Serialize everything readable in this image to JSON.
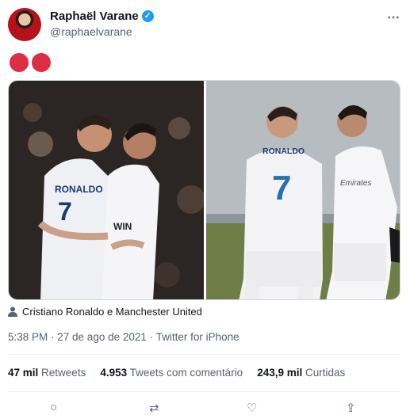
{
  "author": {
    "name": "Raphaël Varane",
    "handle": "@raphaelvarane",
    "verified_mark": "✓"
  },
  "tweet": {
    "emojis": [
      "red-circle",
      "red-circle"
    ],
    "tagged": "Cristiano Ronaldo e Manchester United",
    "timestamp": "5:38 PM · 27 de ago de 2021 · Twitter for iPhone"
  },
  "photos": {
    "left": {
      "jersey_name": "RONALDO",
      "jersey_number": "7",
      "sponsor": "WIN"
    },
    "right": {
      "jersey_name": "RONALDO",
      "jersey_number": "7",
      "sponsor": "Emirates"
    }
  },
  "stats": {
    "retweets_count": "47 mil",
    "retweets_label": "Retweets",
    "quotes_count": "4.953",
    "quotes_label": "Tweets com comentário",
    "likes_count": "243,9 mil",
    "likes_label": "Curtidas"
  },
  "icons": {
    "more": "⋯",
    "reply": "○",
    "retweet": "⇄",
    "like": "♡",
    "share": "⇪"
  },
  "colors": {
    "accent": "#1d9bf0",
    "emoji_red": "#dd2e44",
    "muted_text": "#536471"
  }
}
